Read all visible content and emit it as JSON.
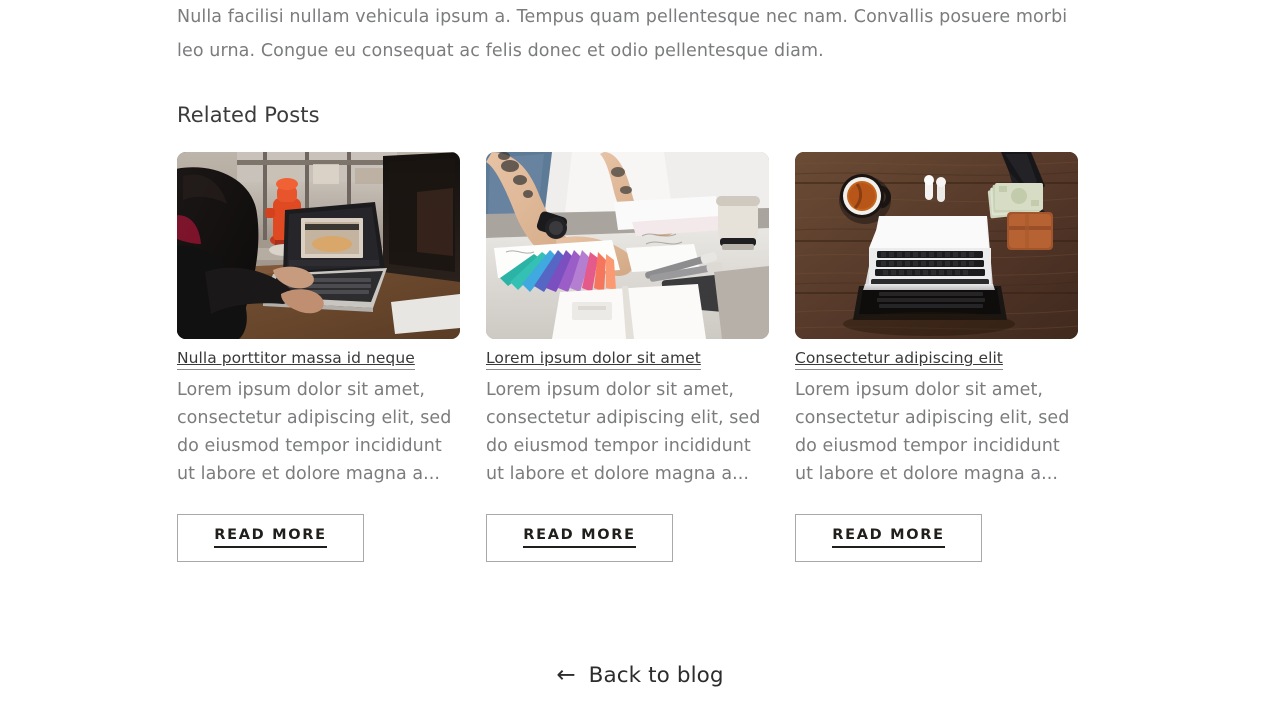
{
  "article": {
    "closing_paragraph": "Nulla facilisi nullam vehicula ipsum a. Tempus quam pellentesque nec nam. Convallis posuere morbi leo urna. Congue eu consequat ac felis donec et odio pellentesque diam."
  },
  "related": {
    "heading": "Related Posts",
    "posts": [
      {
        "title": "Nulla porttitor massa id neque",
        "excerpt": "Lorem ipsum dolor sit amet, consectetur adipiscing elit, sed do eiusmod tempor incididunt ut labore et dolore magna a...",
        "button_label": "READ MORE",
        "image_alt": "woman-editing-video-on-laptop-by-window"
      },
      {
        "title": "Lorem ipsum dolor sit amet",
        "excerpt": "Lorem ipsum dolor sit amet, consectetur adipiscing elit, sed do eiusmod tempor incididunt ut labore et dolore magna a...",
        "button_label": "READ MORE",
        "image_alt": "designer-hands-with-color-swatches-and-markers"
      },
      {
        "title": "Consectetur adipiscing elit",
        "excerpt": "Lorem ipsum dolor sit amet, consectetur adipiscing elit, sed do eiusmod tempor incididunt ut labore et dolore magna a...",
        "button_label": "READ MORE",
        "image_alt": "laptop-tea-cash-wallet-on-wooden-desk-flatlay"
      }
    ]
  },
  "footer": {
    "back_arrow": "←",
    "back_label": "Back to blog"
  },
  "colors": {
    "body_text": "#7b7c7e",
    "heading_text": "#3b3b3d",
    "button_text": "#211f1c",
    "button_border": "#a9a9ab",
    "background": "#ffffff"
  }
}
